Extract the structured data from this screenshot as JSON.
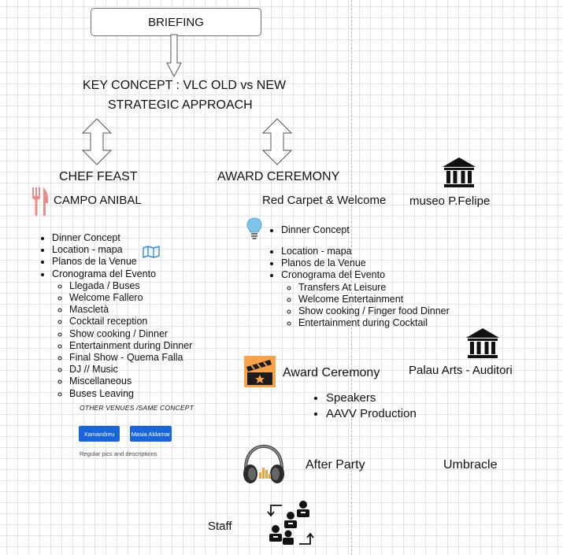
{
  "briefing": "BRIEFING",
  "key_concept": "KEY CONCEPT : VLC OLD vs NEW",
  "strategic_approach": "STRATEGIC APPROACH",
  "chef_feast": {
    "title": "CHEF FEAST",
    "venue": "CAMPO ANIBAL",
    "items": [
      "Dinner Concept",
      "Location - mapa",
      "Planos de la Venue",
      "Cronograma del Evento"
    ],
    "schedule": [
      "Llegada / Buses",
      "Welcome Fallero",
      "Mascletà",
      "Cocktail reception",
      "Show cooking / Dinner",
      "Entertainment during Dinner",
      "Final Show - Quema Falla",
      "DJ // Music",
      "Miscellaneous",
      "Buses Leaving"
    ],
    "other_venues": "OTHER VENUES /SAME CONCEPT",
    "venue_buttons": [
      "Xamandreu",
      "Masia Aldamar"
    ],
    "note": "Regular pics and descriptions"
  },
  "award_ceremony": {
    "title": "AWARD CEREMONY",
    "subtitle": "Red Carpet & Welcome",
    "venue": "museo P.Felipe",
    "items_first": "Dinner Concept",
    "items": [
      "Location - mapa",
      "Planos de la Venue",
      "Cronograma del Evento"
    ],
    "schedule": [
      "Transfers At Leisure",
      "Welcome Entertainment",
      "Show cooking / Finger food Dinner",
      "Entertainment during Cocktail"
    ]
  },
  "ceremony": {
    "title": "Award Ceremony",
    "venue": "Palau Arts - Auditori",
    "items": [
      "Speakers",
      "AAVV Production"
    ]
  },
  "after_party": {
    "title": "After Party",
    "venue": "Umbracle"
  },
  "staff": "Staff",
  "icons": {
    "fork_knife": "fork-knife-icon",
    "map": "map-icon",
    "bulb": "lightbulb-icon",
    "museum": "museum-icon",
    "clapper": "clapperboard-icon",
    "headphones": "headphones-icon",
    "staff": "staff-people-icon"
  },
  "colors": {
    "button_blue": "#1a65d8",
    "cutlery_pink": "#f08a8a",
    "map_blue": "#3c8de0",
    "bulb_blue": "#7fc4e8",
    "clapper_orange": "#f7a34b"
  }
}
